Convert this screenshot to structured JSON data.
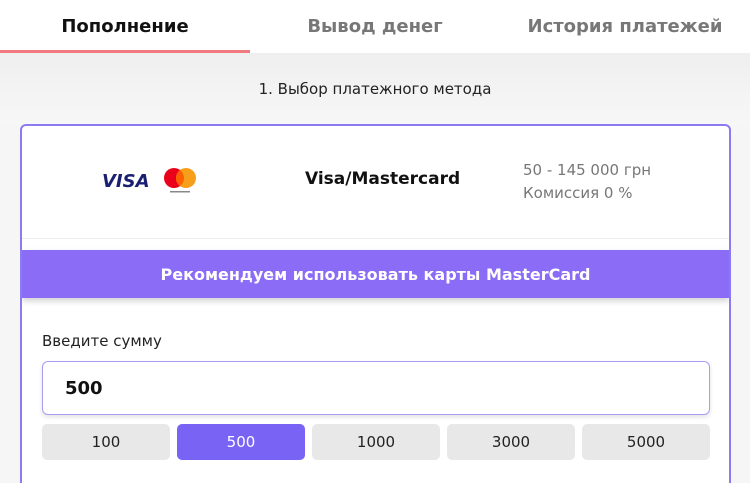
{
  "tabs": [
    {
      "label": "Пополнение",
      "active": true
    },
    {
      "label": "Вывод денег",
      "active": false
    },
    {
      "label": "История платежей",
      "active": false
    }
  ],
  "step_title": "1. Выбор платежного метода",
  "method": {
    "logo_text": "VISA",
    "name": "Visa/Mastercard",
    "limits": "50 - 145 000 грн",
    "commission": "Комиссия 0 %"
  },
  "banner": "Рекомендуем использовать карты MasterCard",
  "amount": {
    "label": "Введите сумму",
    "value": "500"
  },
  "quick_amounts": [
    {
      "label": "100",
      "selected": false
    },
    {
      "label": "500",
      "selected": true
    },
    {
      "label": "1000",
      "selected": false
    },
    {
      "label": "3000",
      "selected": false
    },
    {
      "label": "5000",
      "selected": false
    }
  ],
  "colors": {
    "accent": "#8a6cf6",
    "tab_underline": "#f07a80",
    "mastercard_red": "#eb001b",
    "mastercard_orange": "#f79e1b",
    "visa_blue": "#1a1f71"
  }
}
